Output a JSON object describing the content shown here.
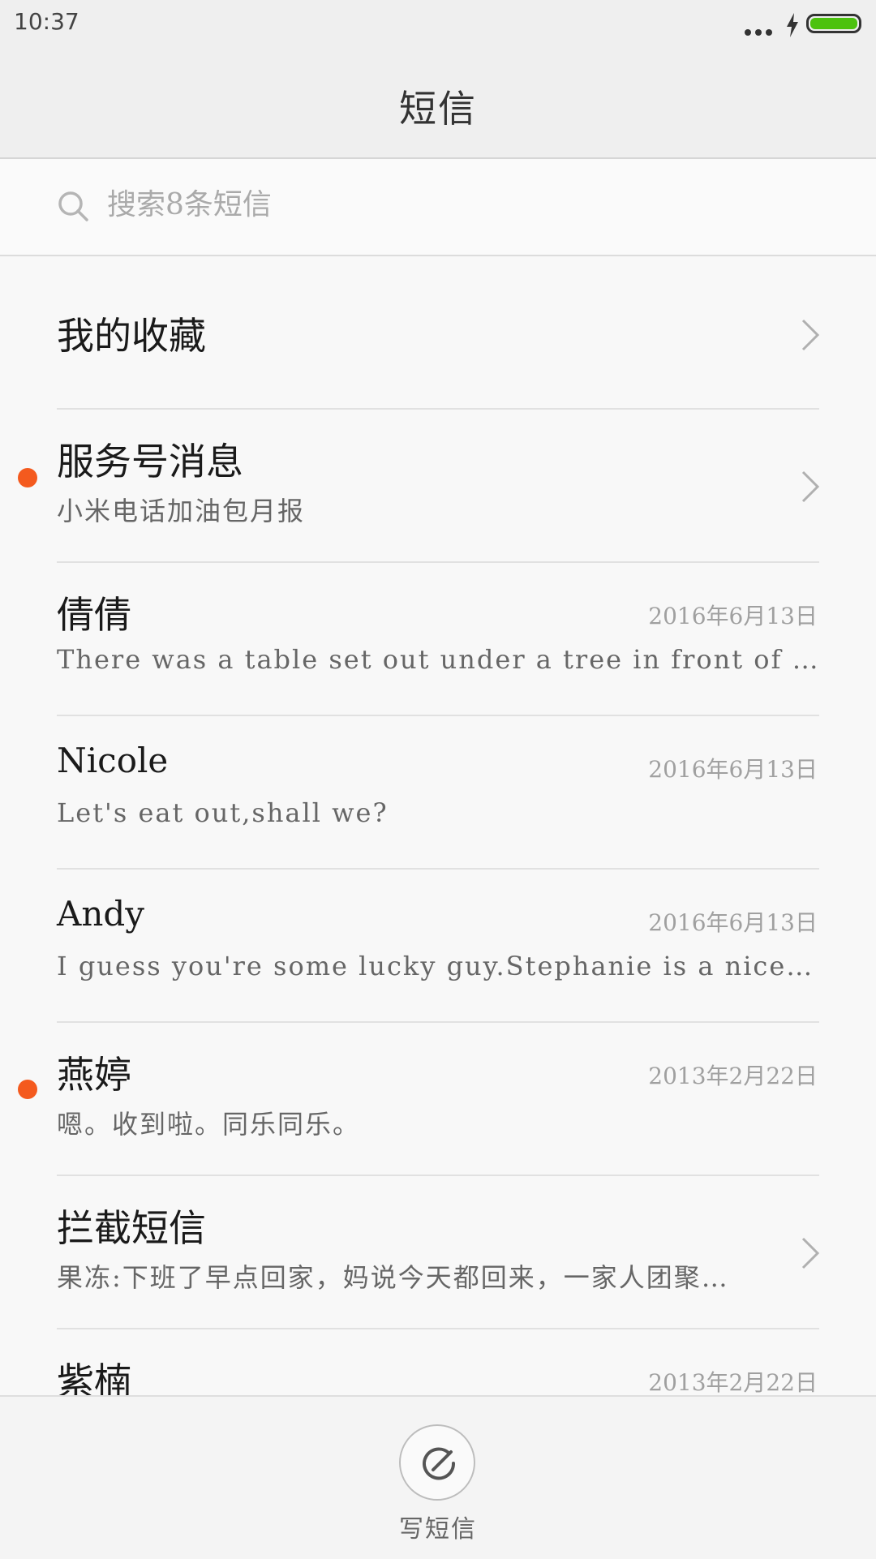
{
  "status_bar": {
    "time": "10:37",
    "battery_color": "#4cc20e"
  },
  "header": {
    "title": "短信"
  },
  "search": {
    "placeholder": "搜索8条短信",
    "icon": "search-icon"
  },
  "conversations": [
    {
      "name": "我的收藏",
      "snippet": "",
      "date": "",
      "unread": false,
      "chevron": true
    },
    {
      "name": "服务号消息",
      "snippet": "小米电话加油包月报",
      "date": "",
      "unread": true,
      "chevron": true
    },
    {
      "name": "倩倩",
      "snippet": "There was a table set out under a tree in front of the h…",
      "date": "2016年6月13日",
      "unread": false,
      "chevron": false
    },
    {
      "name": "Nicole",
      "snippet": "Let's eat out,shall we?",
      "date": "2016年6月13日",
      "unread": false,
      "chevron": false
    },
    {
      "name": "Andy",
      "snippet": "I guess you're some lucky guy.Stephanie is a nice girl.",
      "date": "2016年6月13日",
      "unread": false,
      "chevron": false
    },
    {
      "name": "燕婷",
      "snippet": "嗯。收到啦。同乐同乐。",
      "date": "2013年2月22日",
      "unread": true,
      "chevron": false
    },
    {
      "name": "拦截短信",
      "snippet": "果冻:下班了早点回家，妈说今天都回来，一家人团聚…",
      "date": "",
      "unread": false,
      "chevron": true
    },
    {
      "name": "紫楠",
      "snippet": "",
      "date": "2013年2月22日",
      "unread": false,
      "chevron": false
    }
  ],
  "bottom_bar": {
    "compose_label": "写短信",
    "icon": "compose-icon"
  },
  "colors": {
    "unread_dot": "#f45a1e",
    "accent_battery": "#4cc20e"
  }
}
